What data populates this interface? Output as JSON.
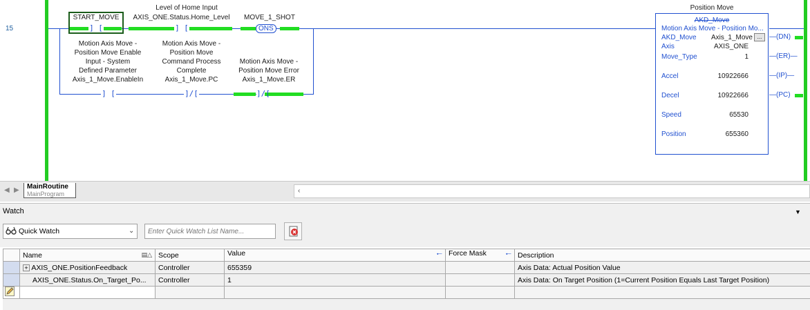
{
  "ladder": {
    "rung_number": "15",
    "contacts": [
      {
        "tag": "START_MOVE",
        "desc_lines": [],
        "sym": "] ["
      },
      {
        "tag": "AXIS_ONE.Status.Home_Level",
        "desc_lines": [
          "Level of Home Input"
        ],
        "sym": "] ["
      },
      {
        "tag": "MOVE_1_SHOT",
        "coil": "ONS"
      },
      {
        "tag": "Axis_1_Move.EnableIn",
        "desc_lines": [
          "Motion Axis Move -",
          "Position Move Enable",
          "Input - System",
          "Defined Parameter"
        ],
        "sym": "] ["
      },
      {
        "tag": "Axis_1_Move.PC",
        "desc_lines": [
          "Motion Axis Move -",
          "Position Move",
          "Command Process",
          "Complete"
        ],
        "sym": "]/["
      },
      {
        "tag": "Axis_1_Move.ER",
        "desc_lines": [
          "Motion Axis Move -",
          "Position Move Error"
        ],
        "sym": "]/["
      }
    ],
    "instruction": {
      "title": "Position Move",
      "name": "AKD_Move",
      "header": "Motion Axis Move - Position Mo...",
      "rows": [
        {
          "label": "AKD_Move",
          "value": "Axis_1_Move"
        },
        {
          "label": "Axis",
          "value": "AXIS_ONE"
        },
        {
          "label": "Move_Type",
          "value": "1"
        },
        {
          "label": "Accel",
          "value": "10922666"
        },
        {
          "label": "Decel",
          "value": "10922666"
        },
        {
          "label": "Speed",
          "value": "65530"
        },
        {
          "label": "Position",
          "value": "655360"
        }
      ],
      "browse_label": "...",
      "outputs": [
        "DN",
        "ER",
        "IP",
        "PC"
      ]
    },
    "tab": {
      "routine": "MainRoutine",
      "program": "MainProgram"
    }
  },
  "watch": {
    "title": "Watch",
    "dropdown_value": "Quick Watch",
    "list_name_placeholder": "Enter Quick Watch List Name...",
    "columns": [
      "Name",
      "Scope",
      "Value",
      "Force Mask",
      "Description"
    ],
    "rows": [
      {
        "expander": "+",
        "name": "AXIS_ONE.PositionFeedback",
        "scope": "Controller",
        "value": "655359",
        "force": "",
        "description": "Axis Data:  Actual Position Value"
      },
      {
        "expander": "",
        "name": "AXIS_ONE.Status.On_Target_Po...",
        "scope": "Controller",
        "value": "1",
        "force": "",
        "description": "Axis Data:  On Target Position (1=Current Position Equals Last Target Position)"
      }
    ]
  },
  "icons": {
    "quick_watch": "watch-glasses-icon",
    "clear": "clear-list-icon",
    "new_row": "pencil-icon",
    "sort": "sort-icon",
    "filter": "filter-icon"
  },
  "colors": {
    "energized": "#22dd22",
    "wire": "#2050d0",
    "selected": "#d3dcef"
  }
}
